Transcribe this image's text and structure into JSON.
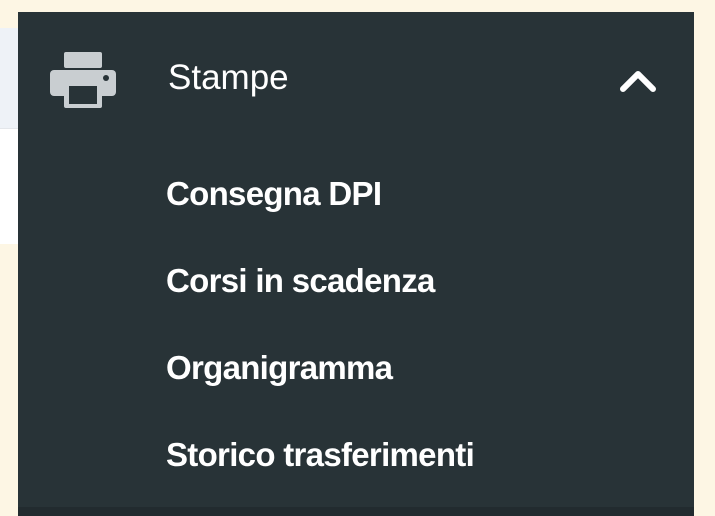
{
  "menu": {
    "section_label": "Stampe",
    "section_icon": "printer-icon",
    "toggle_icon": "chevron-up-icon",
    "expanded": true,
    "items": [
      {
        "label": "Consegna DPI"
      },
      {
        "label": "Corsi in scadenza"
      },
      {
        "label": "Organigramma"
      },
      {
        "label": "Storico trasferimenti"
      }
    ]
  },
  "colors": {
    "sidebar_bg": "#283337",
    "text": "#ffffff",
    "icon": "#c9ced1",
    "page_bg": "#fdf6e4"
  }
}
